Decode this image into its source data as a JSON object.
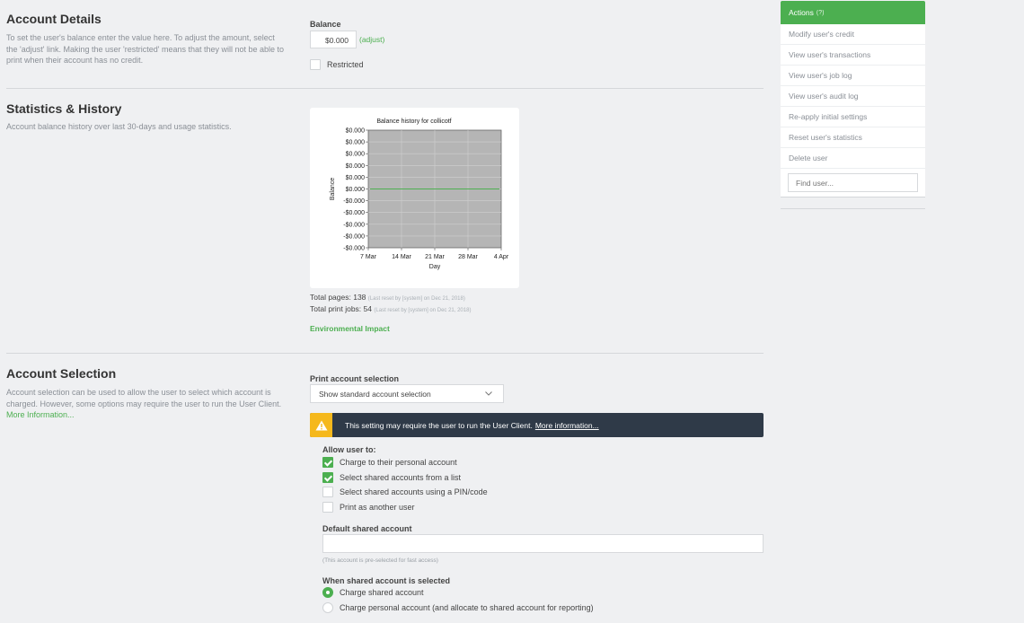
{
  "account_details": {
    "title": "Account Details",
    "description": "To set the user's balance enter the value here. To adjust the amount, select the 'adjust' link. Making the user 'restricted' means that they will not be able to print when their account has no credit.",
    "balance_label": "Balance",
    "balance_value": "$0.000",
    "adjust_link": "(adjust)",
    "restricted_label": "Restricted",
    "restricted_checked": false
  },
  "stats": {
    "title": "Statistics & History",
    "description": "Account balance history over last 30-days and usage statistics.",
    "total_pages_label": "Total pages:",
    "total_pages_value": "138",
    "total_pages_note": "(Last reset by [system] on Dec 21, 2018)",
    "total_jobs_label": "Total print jobs:",
    "total_jobs_value": "54",
    "total_jobs_note": "(Last reset by [system] on Dec 21, 2018)",
    "env_link": "Environmental Impact"
  },
  "chart_data": {
    "type": "line",
    "title": "Balance history for collicotf",
    "xlabel": "Day",
    "ylabel": "Balance",
    "x_ticks": [
      "7 Mar",
      "14 Mar",
      "21 Mar",
      "28 Mar",
      "4 Apr"
    ],
    "y_ticks": [
      "$0.000",
      "$0.000",
      "$0.000",
      "$0.000",
      "$0.000",
      "$0.000",
      "-$0.000",
      "-$0.000",
      "-$0.000",
      "-$0.000",
      "-$0.000"
    ],
    "series": [
      {
        "x": [
          "7 Mar",
          "4 Apr"
        ],
        "values": [
          0,
          0
        ],
        "color": "#4caf50"
      }
    ],
    "grid": true,
    "plot_bg": "#b5b5b5"
  },
  "account_selection": {
    "title": "Account Selection",
    "description": "Account selection can be used to allow the user to select which account is charged. However, some options may require the user to run the User Client.",
    "more_info": "More Information...",
    "print_label": "Print account selection",
    "print_value": "Show standard account selection",
    "warning_text": "This setting may require the user to run the User Client.",
    "warning_link": "More information...",
    "allow_label": "Allow user to:",
    "options": [
      {
        "label": "Charge to their personal account",
        "checked": true
      },
      {
        "label": "Select shared accounts from a list",
        "checked": true
      },
      {
        "label": "Select shared accounts using a PIN/code",
        "checked": false
      },
      {
        "label": "Print as another user",
        "checked": false
      }
    ],
    "default_label": "Default shared account",
    "default_value": "",
    "default_hint": "(This account is pre-selected for fast access)",
    "when_label": "When shared account is selected",
    "radios": [
      {
        "label": "Charge shared account",
        "selected": true
      },
      {
        "label": "Charge personal account (and allocate to shared account for reporting)",
        "selected": false
      }
    ]
  },
  "sidebar": {
    "header": "Actions",
    "header_hint": "(?)",
    "items": [
      {
        "label": "Modify user's credit"
      },
      {
        "label": "View user's transactions"
      },
      {
        "label": "View user's job log"
      },
      {
        "label": "View user's audit log"
      },
      {
        "label": "Re-apply initial settings"
      },
      {
        "label": "Reset user's statistics"
      },
      {
        "label": "Delete user"
      }
    ],
    "find_placeholder": "Find user..."
  },
  "colors": {
    "accent": "#4caf50",
    "warning_bg": "#2f3a48",
    "warning_icon": "#f5b81c"
  }
}
